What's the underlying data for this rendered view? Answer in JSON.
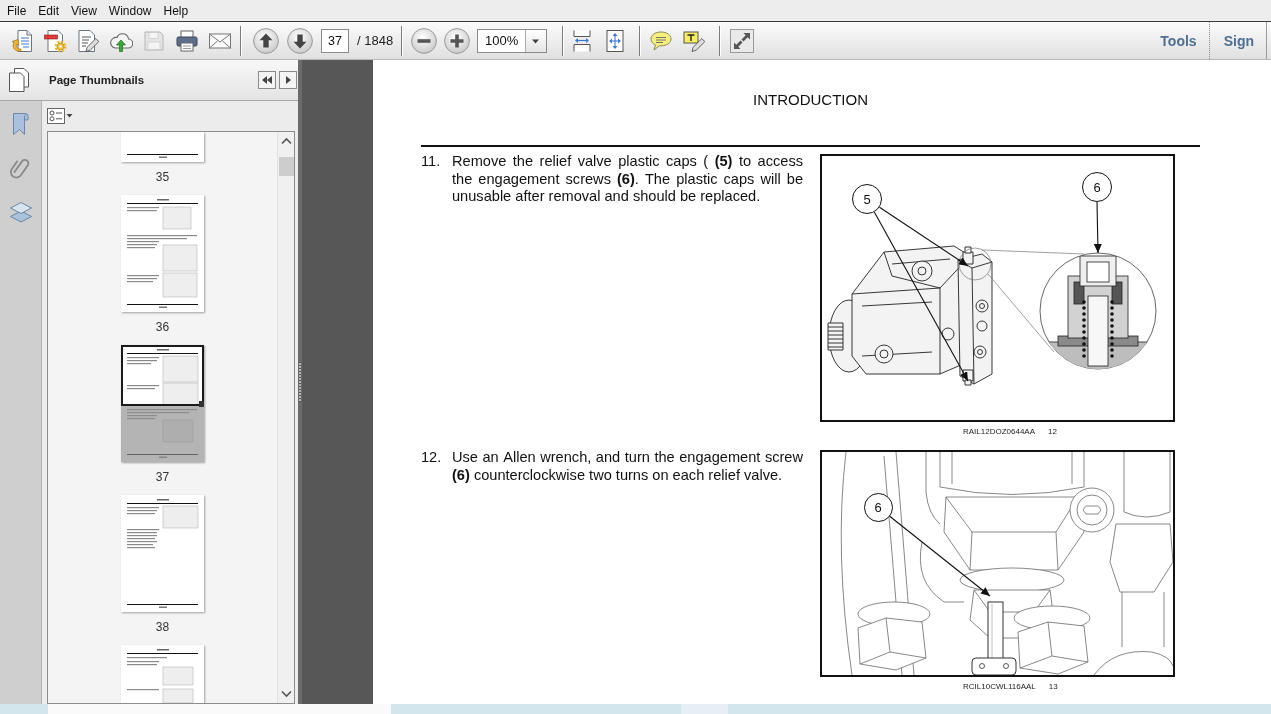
{
  "menu_bar": [
    "File",
    "Edit",
    "View",
    "Window",
    "Help"
  ],
  "toolbar": {
    "save": {
      "disabled": true
    },
    "page_number": "37",
    "page_count": "/ 1848",
    "zoom": "100%",
    "panels": [
      "Tools",
      "Sign"
    ]
  },
  "side_panel": {
    "title": "Page Thumbnails",
    "thumbnails": [
      {
        "label": "35",
        "selected": false
      },
      {
        "label": "36",
        "selected": false
      },
      {
        "label": "37",
        "selected": true
      },
      {
        "label": "38",
        "selected": false
      },
      {
        "selected": false
      }
    ]
  },
  "document": {
    "heading": "INTRODUCTION",
    "steps": [
      {
        "number": "11.",
        "text": "Remove the relief valve plastic caps ( **(5)** to access the engagement screws **(6)**. The plastic caps will be unusable after removal and should be replaced.",
        "figure": {
          "kind": "pump",
          "callouts": [
            "5",
            "6"
          ],
          "code": "RAIL12DOZ0644AA",
          "number": "12"
        }
      },
      {
        "number": "12.",
        "text": "Use an Allen wrench, and turn the engagement screw **(6)** counterclockwise two turns on each relief valve.",
        "figure": {
          "kind": "wrench",
          "callouts": [
            "6"
          ],
          "code": "RCIL10CWL116AAL",
          "number": "13"
        }
      }
    ]
  }
}
